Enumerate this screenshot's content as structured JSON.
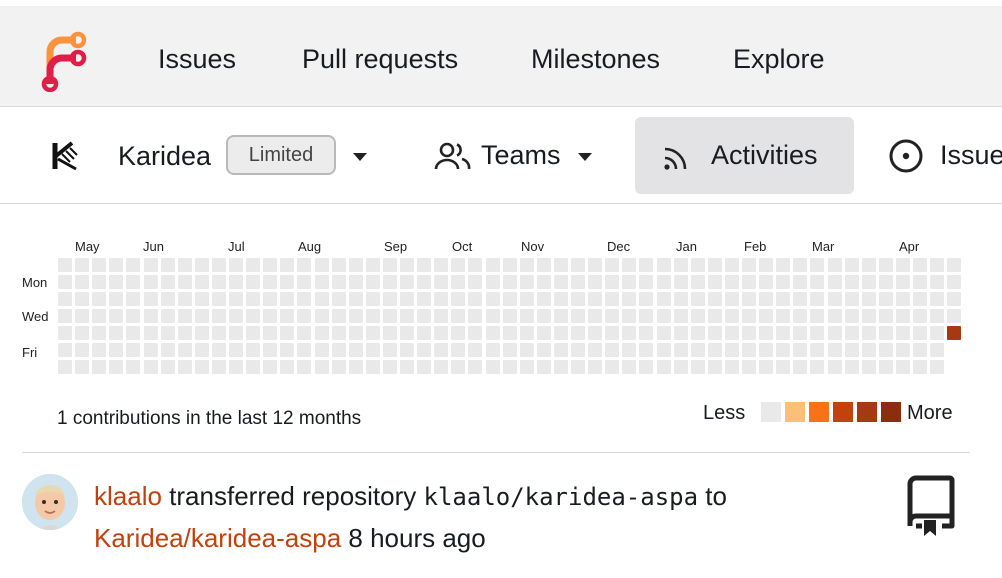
{
  "navbar": {
    "items": [
      {
        "label": "Issues"
      },
      {
        "label": "Pull requests"
      },
      {
        "label": "Milestones"
      },
      {
        "label": "Explore"
      }
    ]
  },
  "org": {
    "name": "Karidea",
    "badge": "Limited",
    "tabs": [
      {
        "label": "Teams",
        "icon": "people-icon"
      },
      {
        "label": "Activities",
        "icon": "rss-icon",
        "active": true
      },
      {
        "label": "Issues",
        "icon": "issue-opened-icon"
      }
    ]
  },
  "heatmap": {
    "months": [
      "May",
      "Jun",
      "Jul",
      "Aug",
      "Sep",
      "Oct",
      "Nov",
      "Dec",
      "Jan",
      "Feb",
      "Mar",
      "Apr"
    ],
    "days": [
      "Mon",
      "Wed",
      "Fri"
    ],
    "summary": "1 contributions in the last 12 months",
    "legend_less": "Less",
    "legend_more": "More",
    "colors": {
      "empty": "#e9e9ea",
      "scale": [
        "#e9e9ea",
        "#fbbf77",
        "#f97316",
        "#c2410c",
        "#a53a12",
        "#8a2e0f"
      ]
    },
    "contributions": [
      {
        "week": 52,
        "day": 4,
        "level": 4
      }
    ]
  },
  "feed": {
    "items": [
      {
        "user": "klaalo",
        "action": "transferred repository",
        "from_repo": "klaalo/karidea-aspa",
        "to_word": "to",
        "to_repo": "Karidea/karidea-aspa",
        "time": "8 hours ago",
        "icon": "repo-icon"
      }
    ]
  },
  "theme": {
    "accent": "#c2410c",
    "logo_orange": "#fb923c",
    "logo_red": "#e11d48"
  }
}
